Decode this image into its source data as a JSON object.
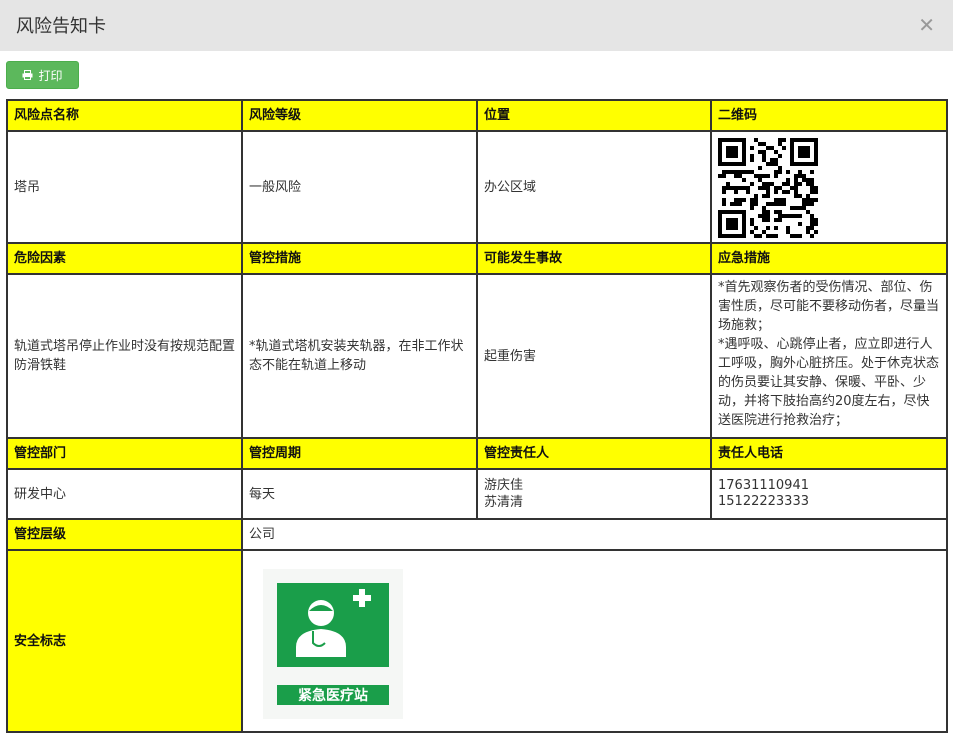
{
  "dialog": {
    "title": "风险告知卡",
    "close_icon": "close-icon"
  },
  "toolbar": {
    "print_label": "打印",
    "print_icon": "print-icon",
    "button_color": "#5cb85c"
  },
  "card": {
    "header_color": "#ffff00",
    "row1_headers": [
      "风险点名称",
      "风险等级",
      "位置",
      "二维码"
    ],
    "risk_point_name": "塔吊",
    "risk_level": "一般风险",
    "location": "办公区域",
    "row2_headers": [
      "危险因素",
      "管控措施",
      "可能发生事故",
      "应急措施"
    ],
    "hazard_factor": "轨道式塔吊停止作业时没有按规范配置防滑铁鞋",
    "control_measure": "*轨道式塔机安装夹轨器，在非工作状态不能在轨道上移动",
    "possible_accident": "起重伤害",
    "emergency_measure": [
      "*首先观察伤者的受伤情况、部位、伤害性质，尽可能不要移动伤者，尽量当场施救；",
      "*遇呼吸、心跳停止者，应立即进行人工呼吸，胸外心脏挤压。处于休克状态的伤员要让其安静、保暖、平卧、少动，并将下肢抬高约20度左右，尽快送医院进行抢救治疗；"
    ],
    "row3_headers": [
      "管控部门",
      "管控周期",
      "管控责任人",
      "责任人电话"
    ],
    "control_department": "研发中心",
    "control_cycle": "每天",
    "responsible_persons": [
      "游庆佳",
      "苏清清"
    ],
    "responsible_phones": [
      "17631110941",
      "15122223333"
    ],
    "control_level_label": "管控层级",
    "control_level": "公司",
    "safety_sign_label": "安全标志",
    "safety_sign_text": "紧急医疗站",
    "safety_sign_color": "#1a9e4a"
  }
}
